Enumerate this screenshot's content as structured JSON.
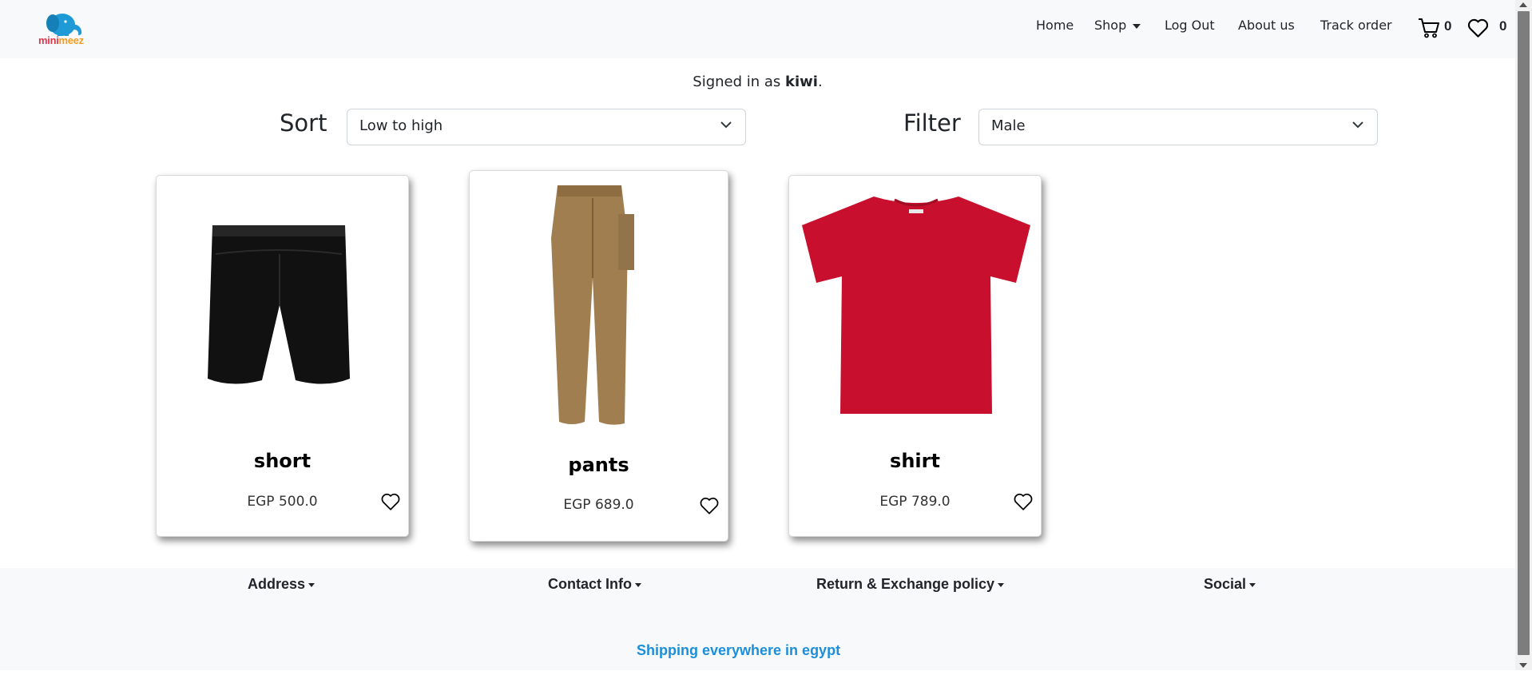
{
  "brand": {
    "part1": "mini",
    "part2": "meez"
  },
  "nav": {
    "home": "Home",
    "shop": "Shop",
    "logout": "Log Out",
    "about": "About us",
    "track": "Track order",
    "cart_count": "0",
    "wishlist_count": "0"
  },
  "signed_in": {
    "prefix": "Signed in as ",
    "user": "kiwi",
    "suffix": "."
  },
  "sort": {
    "label": "Sort",
    "value": "Low to high"
  },
  "filter": {
    "label": "Filter",
    "value": "Male"
  },
  "products": [
    {
      "name": "short",
      "price": "EGP 500.0"
    },
    {
      "name": "pants",
      "price": "EGP 689.0"
    },
    {
      "name": "shirt",
      "price": "EGP 789.0"
    }
  ],
  "footer": {
    "address": "Address",
    "contact": "Contact Info",
    "policy": "Return & Exchange policy",
    "social": "Social",
    "shipping": "Shipping everywhere in egypt"
  },
  "colors": {
    "accent": "#1b8fd9",
    "navbar_bg": "#f8f9fa",
    "brand_red": "#e4364b",
    "brand_orange": "#f39c1e"
  }
}
